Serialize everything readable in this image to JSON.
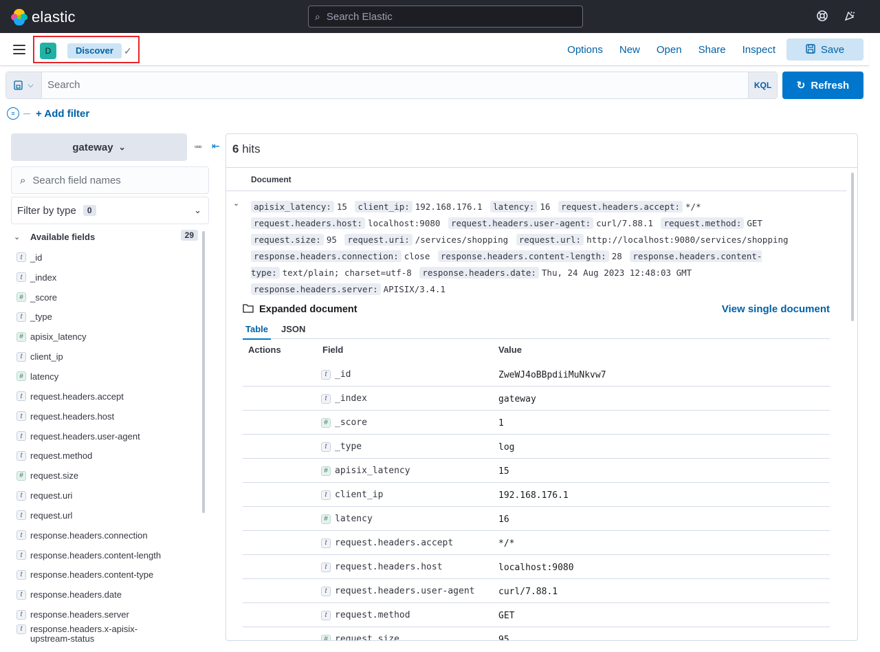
{
  "header": {
    "brand": "elastic",
    "search_placeholder": "Search Elastic"
  },
  "appbar": {
    "space_initial": "D",
    "breadcrumb": "Discover",
    "links": [
      "Options",
      "New",
      "Open",
      "Share",
      "Inspect"
    ],
    "save_label": "Save"
  },
  "query": {
    "placeholder": "Search",
    "language": "KQL",
    "refresh_label": "Refresh",
    "add_filter": "+ Add filter"
  },
  "sidebar": {
    "index_pattern": "gateway",
    "search_placeholder": "Search field names",
    "filter_by_type": "Filter by type",
    "filter_count": "0",
    "available_label": "Available fields",
    "available_count": "29",
    "fields": [
      {
        "name": "_id",
        "type": "t"
      },
      {
        "name": "_index",
        "type": "t"
      },
      {
        "name": "_score",
        "type": "#"
      },
      {
        "name": "_type",
        "type": "t"
      },
      {
        "name": "apisix_latency",
        "type": "#"
      },
      {
        "name": "client_ip",
        "type": "t"
      },
      {
        "name": "latency",
        "type": "#"
      },
      {
        "name": "request.headers.accept",
        "type": "t"
      },
      {
        "name": "request.headers.host",
        "type": "t"
      },
      {
        "name": "request.headers.user-agent",
        "type": "t"
      },
      {
        "name": "request.method",
        "type": "t"
      },
      {
        "name": "request.size",
        "type": "#"
      },
      {
        "name": "request.uri",
        "type": "t"
      },
      {
        "name": "request.url",
        "type": "t"
      },
      {
        "name": "response.headers.connection",
        "type": "t"
      },
      {
        "name": "response.headers.content-length",
        "type": "t"
      },
      {
        "name": "response.headers.content-type",
        "type": "t"
      },
      {
        "name": "response.headers.date",
        "type": "t"
      },
      {
        "name": "response.headers.server",
        "type": "t"
      },
      {
        "name": "response.headers.x-apisix-upstream-status",
        "type": "t",
        "line1": "response.headers.x-apisix-",
        "line2": "upstream-status"
      }
    ]
  },
  "results": {
    "hits_count": "6",
    "hits_label": "hits",
    "document_col": "Document",
    "document_pairs": [
      {
        "k": "apisix_latency:",
        "v": "15"
      },
      {
        "k": "client_ip:",
        "v": "192.168.176.1"
      },
      {
        "k": "latency:",
        "v": "16"
      },
      {
        "k": "request.headers.accept:",
        "v": "*/*"
      },
      {
        "k": "request.headers.host:",
        "v": "localhost:9080"
      },
      {
        "k": "request.headers.user-agent:",
        "v": "curl/7.88.1"
      },
      {
        "k": "request.method:",
        "v": "GET"
      },
      {
        "k": "request.size:",
        "v": "95"
      },
      {
        "k": "request.uri:",
        "v": "/services/shopping"
      },
      {
        "k": "request.url:",
        "v": "http://localhost:9080/services/shopping"
      },
      {
        "k": "response.headers.connection:",
        "v": "close"
      },
      {
        "k": "response.headers.content-length:",
        "v": "28"
      },
      {
        "k": "response.headers.content-type:",
        "v": "text/plain; charset=utf-8"
      },
      {
        "k": "response.headers.date:",
        "v": "Thu, 24 Aug 2023 12:48:03 GMT"
      },
      {
        "k": "response.headers.server:",
        "v": "APISIX/3.4.1"
      }
    ],
    "expanded_title": "Expanded document",
    "view_single": "View single document",
    "tabs": [
      "Table",
      "JSON"
    ],
    "columns": [
      "Actions",
      "Field",
      "Value"
    ],
    "rows": [
      {
        "field": "_id",
        "type": "t",
        "value": "ZweWJ4oBBpdiiMuNkvw7"
      },
      {
        "field": "_index",
        "type": "t",
        "value": "gateway"
      },
      {
        "field": "_score",
        "type": "#",
        "value": "1"
      },
      {
        "field": "_type",
        "type": "t",
        "value": "log"
      },
      {
        "field": "apisix_latency",
        "type": "#",
        "value": "15"
      },
      {
        "field": "client_ip",
        "type": "t",
        "value": "192.168.176.1"
      },
      {
        "field": "latency",
        "type": "#",
        "value": "16"
      },
      {
        "field": "request.headers.accept",
        "type": "t",
        "value": "*/*"
      },
      {
        "field": "request.headers.host",
        "type": "t",
        "value": "localhost:9080"
      },
      {
        "field": "request.headers.user-agent",
        "type": "t",
        "value": "curl/7.88.1"
      },
      {
        "field": "request.method",
        "type": "t",
        "value": "GET"
      },
      {
        "field": "request.size",
        "type": "#",
        "value": "95"
      }
    ]
  }
}
